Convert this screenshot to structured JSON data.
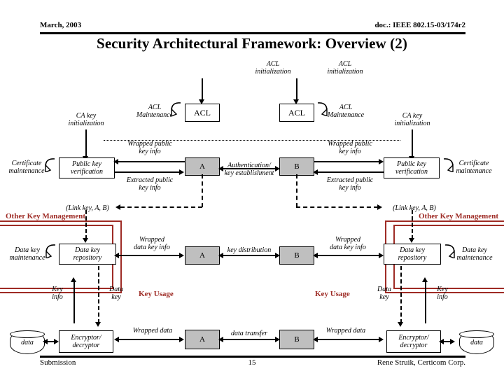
{
  "header": {
    "date": "March, 2003",
    "doc": "doc.: IEEE 802.15-03/174r2",
    "title": "Security Architectural Framework: Overview (2)"
  },
  "footer": {
    "left": "Submission",
    "page": "15",
    "right": "Rene Struik, Certicom Corp."
  },
  "colors": {
    "red": "#9E2B25",
    "entity_fill": "#BFBFBF",
    "line": "#000000"
  },
  "diagram": {
    "acl_init_left": "ACL\ninitialization",
    "acl_init_right": "ACL\ninitialization",
    "acl_box_left": "ACL",
    "acl_box_right": "ACL",
    "acl_maintenance_left": "ACL\nMaintenance",
    "acl_maintenance_right": "ACL\nMaintenance",
    "ca_key_init_left": "CA key\ninitialization",
    "ca_key_init_right": "CA key\ninitialization",
    "certificate_maintenance_left": "Certificate\nmaintenance",
    "certificate_maintenance_right": "Certificate\nmaintenance",
    "public_key_verification_left": "Public key\nverification",
    "public_key_verification_right": "Public key\nverification",
    "wrapped_public_key_info_left": "Wrapped public\nkey info",
    "wrapped_public_key_info_right": "Wrapped public\nkey info",
    "extracted_public_key_info_left": "Extracted public\nkey info",
    "extracted_public_key_info_right": "Extracted public\nkey info",
    "entity_a_top": "A",
    "entity_b_top": "B",
    "authentication_key_establishment": "Authentication/\nkey establishment",
    "link_key_left": "(Link key, A, B)",
    "link_key_right": "(Link key, A, B)",
    "other_key_management_left": "Other Key Management",
    "other_key_management_right": "Other Key Management",
    "data_key_maintenance_left": "Data key\nmaintenance",
    "data_key_maintenance_right": "Data key\nmaintenance",
    "data_key_repository_left": "Data key\nrepository",
    "data_key_repository_right": "Data key\nrepository",
    "wrapped_data_key_info_left": "Wrapped\ndata key info",
    "wrapped_data_key_info_right": "Wrapped\ndata key info",
    "entity_a_mid": "A",
    "entity_b_mid": "B",
    "key_distribution": "key distribution",
    "key_usage_left": "Key Usage",
    "key_usage_right": "Key Usage",
    "key_info_left": "Key\ninfo",
    "key_info_right": "Key\ninfo",
    "data_key_left": "Data\nkey",
    "data_key_right": "Data\nkey",
    "data_store_left": "data",
    "data_store_right": "data",
    "encryptor_decryptor_left": "Encryptor/\ndecryptor",
    "encryptor_decryptor_right": "Encryptor/\ndecryptor",
    "wrapped_data_left": "Wrapped data",
    "wrapped_data_right": "Wrapped data",
    "entity_a_bottom": "A",
    "entity_b_bottom": "B",
    "data_transfer": "data transfer"
  }
}
